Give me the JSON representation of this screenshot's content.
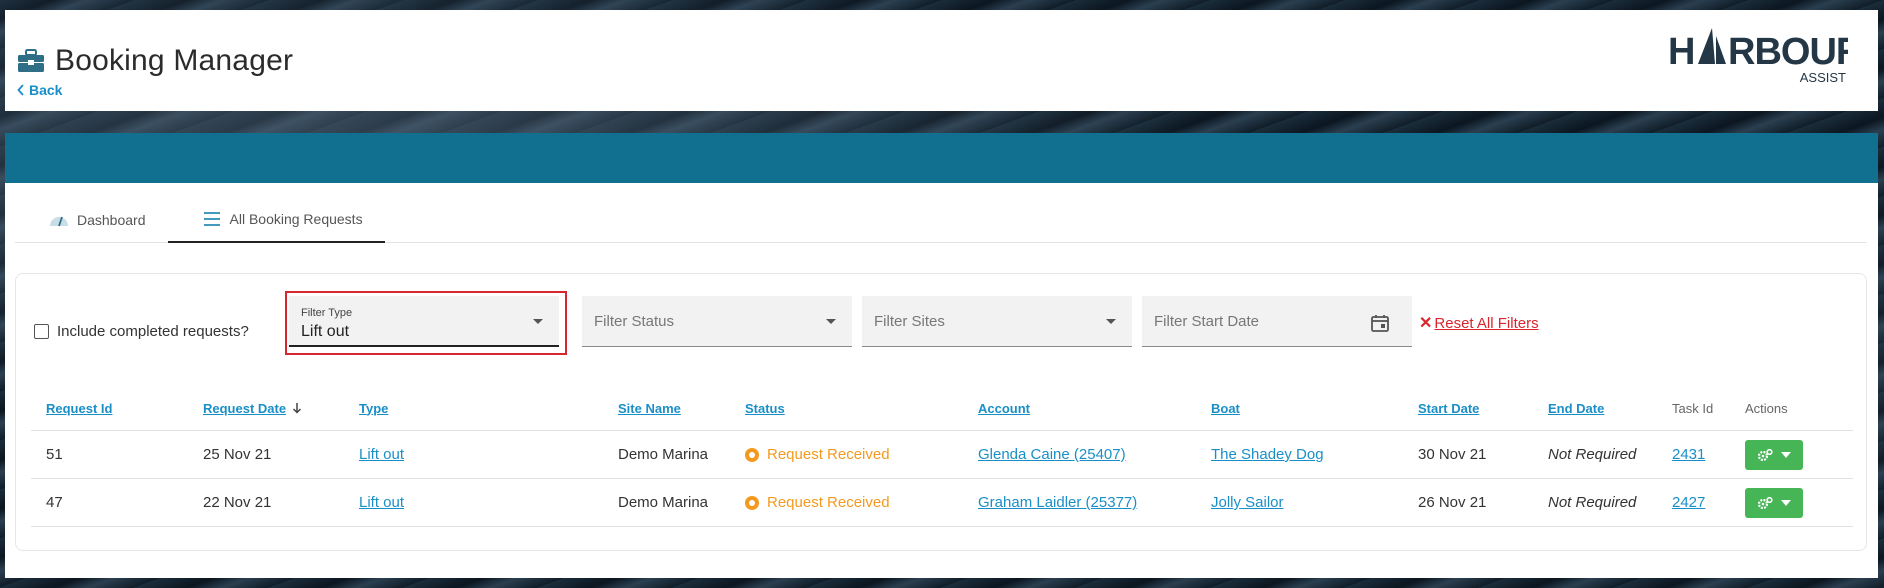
{
  "header": {
    "title": "Booking Manager",
    "back_label": "Back",
    "logo_text": "HARBOUR",
    "logo_sub": "ASSIST"
  },
  "tabs": [
    {
      "label": "Dashboard",
      "icon": "gauge-icon",
      "active": false
    },
    {
      "label": "All Booking Requests",
      "icon": "list-icon",
      "active": true
    }
  ],
  "filters": {
    "include_completed_label": "Include completed requests?",
    "include_completed_checked": false,
    "type": {
      "label": "Filter Type",
      "value": "Lift out"
    },
    "status": {
      "placeholder": "Filter Status"
    },
    "sites": {
      "placeholder": "Filter Sites"
    },
    "start_date": {
      "placeholder": "Filter Start Date"
    },
    "reset_label": "Reset All Filters"
  },
  "table": {
    "columns": [
      "Request Id",
      "Request Date",
      "Type",
      "Site Name",
      "Status",
      "Account",
      "Boat",
      "Start Date",
      "End Date",
      "Task Id",
      "Actions"
    ],
    "rows": [
      {
        "request_id": "51",
        "request_date": "25 Nov 21",
        "type": "Lift out",
        "site": "Demo Marina",
        "status": "Request Received",
        "account": "Glenda Caine (25407)",
        "boat": "The Shadey Dog",
        "start_date": "30 Nov 21",
        "end_date": "Not Required",
        "task_id": "2431"
      },
      {
        "request_id": "47",
        "request_date": "22 Nov 21",
        "type": "Lift out",
        "site": "Demo Marina",
        "status": "Request Received",
        "account": "Graham Laidler (25377)",
        "boat": "Jolly Sailor",
        "start_date": "26 Nov 21",
        "end_date": "Not Required",
        "task_id": "2427"
      }
    ]
  },
  "colors": {
    "band": "#11708f",
    "link": "#1a8fc7",
    "status": "#f39a1e",
    "action": "#45b556",
    "reset": "#d8262e"
  }
}
